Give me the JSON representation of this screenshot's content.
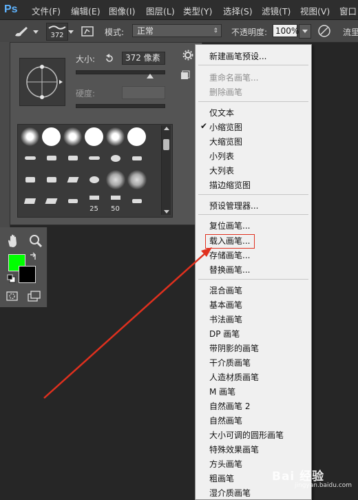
{
  "app": {
    "logo": "Ps"
  },
  "menubar": {
    "items": [
      "文件(F)",
      "编辑(E)",
      "图像(I)",
      "图层(L)",
      "类型(Y)",
      "选择(S)",
      "滤镜(T)",
      "视图(V)",
      "窗口"
    ]
  },
  "options": {
    "brush_size": "372",
    "mode_label": "模式:",
    "mode_value": "正常",
    "opacity_label": "不透明度:",
    "opacity_value": "100%",
    "flow_label": "流里"
  },
  "brush_panel": {
    "size_label": "大小:",
    "size_value": "372 像素",
    "hardness_label": "硬度:",
    "size_slider_value": 0.72,
    "brush_numbers": [
      "25",
      "50"
    ]
  },
  "menu": {
    "new_preset": "新建画笔预设...",
    "rename": "重命名画笔...",
    "delete": "删除画笔",
    "text_only": "仅文本",
    "small_thumb": "小缩览图",
    "large_thumb": "大缩览图",
    "small_list": "小列表",
    "large_list": "大列表",
    "stroke_thumb": "描边缩览图",
    "preset_manager": "预设管理器...",
    "reset": "复位画笔...",
    "load": "载入画笔...",
    "save": "存储画笔...",
    "replace": "替换画笔...",
    "libraries": [
      "混合画笔",
      "基本画笔",
      "书法画笔",
      "DP 画笔",
      "带阴影的画笔",
      "干介质画笔",
      "人造材质画笔",
      "M 画笔",
      "自然画笔 2",
      "自然画笔",
      "大小可调的圆形画笔",
      "特殊效果画笔",
      "方头画笔",
      "粗画笔",
      "湿介质画笔"
    ]
  },
  "watermark": {
    "main": "Bai 经验",
    "sub": "jingyan.baidu.com"
  },
  "colors": {
    "foreground": "#00ff00",
    "background": "#000000",
    "annotation": "#e0301e"
  }
}
